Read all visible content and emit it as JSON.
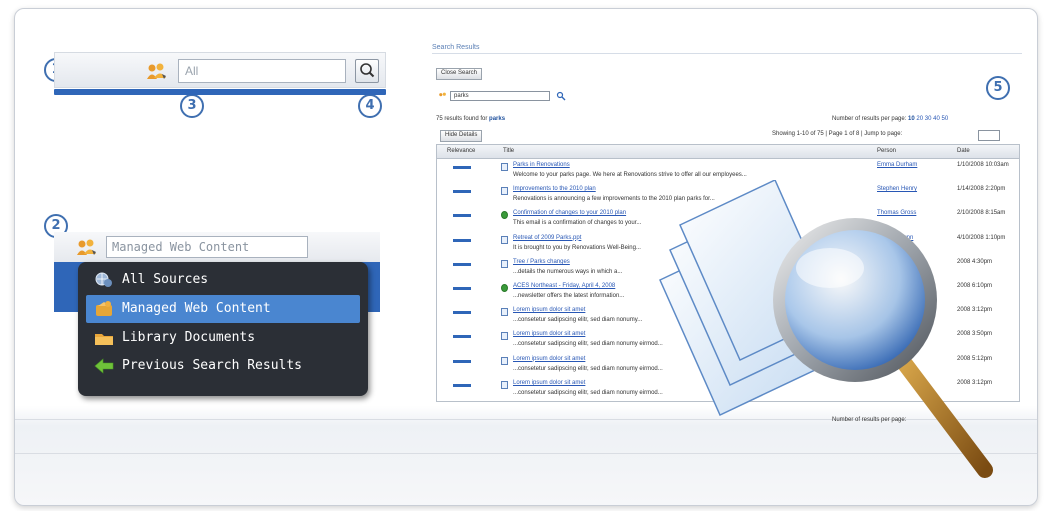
{
  "callouts": [
    "1",
    "2",
    "3",
    "4",
    "5"
  ],
  "search_box": {
    "placeholder": "All",
    "scope_icon": "people-scope-icon",
    "search_icon": "magnifier-icon"
  },
  "scope_selector": {
    "value": "Managed Web Content",
    "menu": [
      {
        "label": "All Sources",
        "icon": "globe-icon"
      },
      {
        "label": "Managed Web Content",
        "icon": "web-content-icon",
        "selected": true
      },
      {
        "label": "Library Documents",
        "icon": "folder-icon"
      },
      {
        "label": "Previous Search Results",
        "icon": "green-arrow-icon"
      }
    ]
  },
  "results": {
    "title": "Search Results",
    "close_label": "Close Search",
    "query": "parks",
    "summary_prefix": "75 results found for",
    "summary_query": "parks",
    "per_page_label": "Number of results per page:",
    "per_page_options": [
      "10",
      "20",
      "30",
      "40",
      "50"
    ],
    "hide_details_label": "Hide Details",
    "showing": "Showing 1-10 of 75",
    "page_info": "Page 1 of 8",
    "jump_label": "Jump to page:",
    "columns": [
      "Relevance",
      "Title",
      "Person",
      "Date"
    ],
    "rows": [
      {
        "title": "Parks in Renovations",
        "desc": "Welcome to your parks page. We here at Renovations strive to offer all our employees...",
        "person": "Emma Durham",
        "date": "1/10/2008 10:03am",
        "relevance": 1.0,
        "icon": "doc"
      },
      {
        "title": "Improvements to the 2010 plan",
        "desc": "Renovations is announcing a few improvements to the 2010 plan parks for...",
        "person": "Stephen Henry",
        "date": "1/14/2008 2:20pm",
        "relevance": 0.9,
        "icon": "doc"
      },
      {
        "title": "Confirmation of changes to your 2010 plan",
        "desc": "This email is a confirmation of changes to your...",
        "person": "Thomas Gross",
        "date": "2/10/2008 8:15am",
        "relevance": 0.75,
        "icon": "green"
      },
      {
        "title": "Retreat of 2009 Parks.ppt",
        "desc": "It is brought to you by Renovations Well-Being...",
        "person": "Patricia Gunn",
        "date": "4/10/2008 1:10pm",
        "relevance": 0.75,
        "icon": "doc"
      },
      {
        "title": "Tree / Parks changes",
        "desc": "...details the numerous ways in which a...",
        "person": "",
        "date": "2008 4:30pm",
        "relevance": 0.75,
        "icon": "doc"
      },
      {
        "title": "ACES Northeast - Friday, April 4, 2008",
        "desc": "...newsletter offers the latest information...",
        "person": "",
        "date": "2008 6:10pm",
        "relevance": 0.75,
        "icon": "green"
      },
      {
        "title": "Lorem ipsum dolor sit amet",
        "desc": "...consetetur sadipscing elitr, sed diam nonumy...",
        "person": "",
        "date": "2008 3:12pm",
        "relevance": 0.6,
        "icon": "doc"
      },
      {
        "title": "Lorem ipsum dolor sit amet",
        "desc": "...consetetur sadipscing elitr, sed diam nonumy eirmod...",
        "person": "",
        "date": "2008 3:50pm",
        "relevance": 0.6,
        "icon": "doc"
      },
      {
        "title": "Lorem ipsum dolor sit amet",
        "desc": "...consetetur sadipscing elitr, sed diam nonumy eirmod...",
        "person": "",
        "date": "2008 5:12pm",
        "relevance": 0.6,
        "icon": "doc"
      },
      {
        "title": "Lorem ipsum dolor sit amet",
        "desc": "...consetetur sadipscing elitr, sed diam nonumy eirmod...",
        "person": "",
        "date": "2008 3:12pm",
        "relevance": 0.6,
        "icon": "doc"
      }
    ],
    "footer_jump": "page:"
  },
  "illustration": "magnifying-glass-over-documents",
  "colors": {
    "accent": "#2f66b8",
    "menu_bg": "#2b2f36",
    "menu_selected": "#4a86d0",
    "callout": "#3f6fb0"
  }
}
